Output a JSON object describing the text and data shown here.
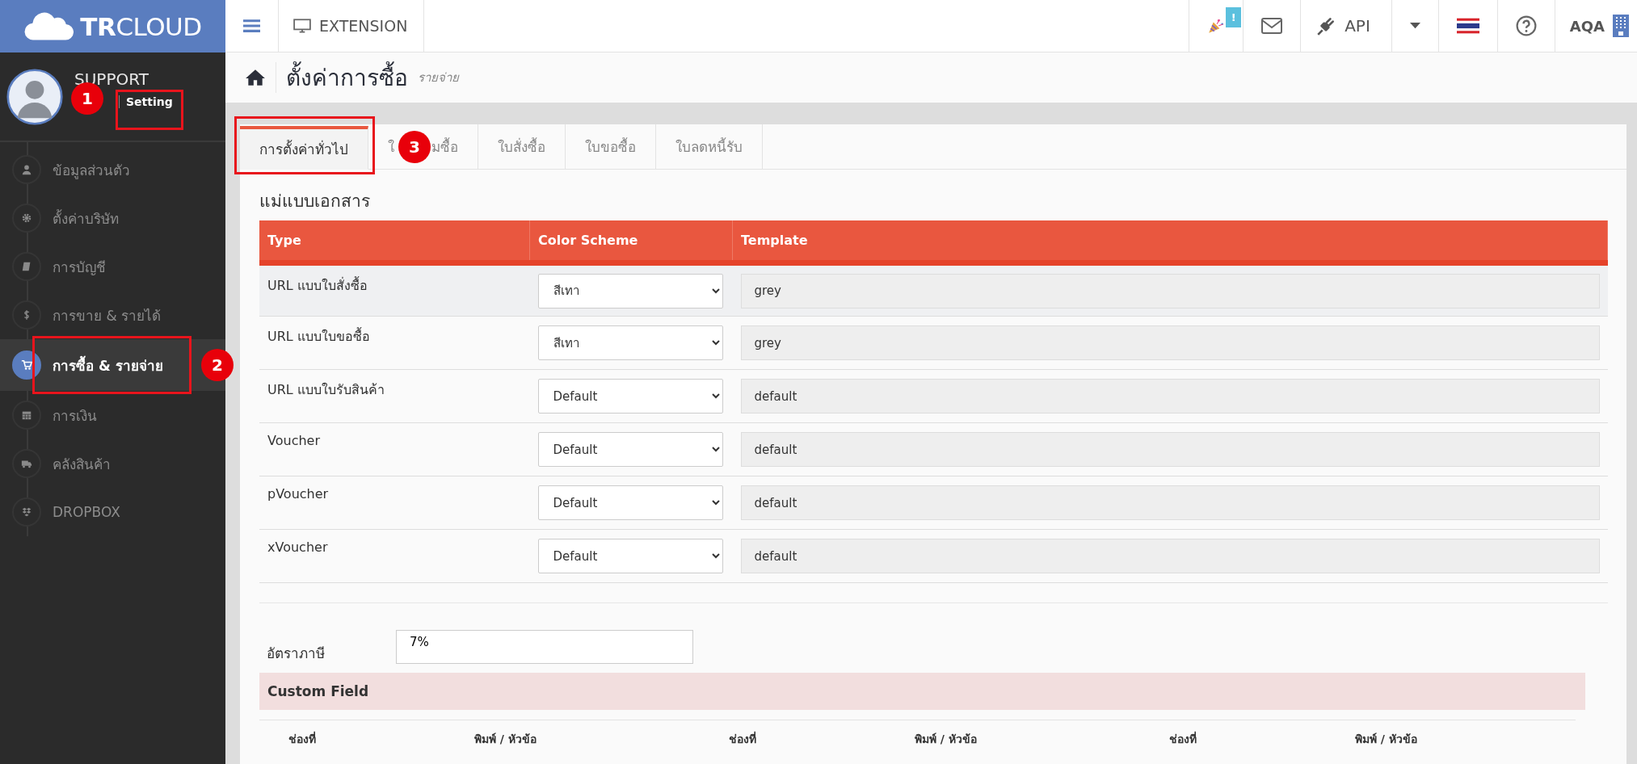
{
  "brand": {
    "name_bold": "TR",
    "name_light": "CLOUD"
  },
  "topbar": {
    "extension": "EXTENSION",
    "notification_badge": "!",
    "api": "API",
    "user": "AQA"
  },
  "profile": {
    "name": "SUPPORT",
    "setting_link": "Setting"
  },
  "sidebar": {
    "items": [
      {
        "label": "ข้อมูลส่วนตัว",
        "selected": false
      },
      {
        "label": "ตั้งค่าบริษัท",
        "selected": false
      },
      {
        "label": "การบัญชี",
        "selected": false
      },
      {
        "label": "การขาย & รายได้",
        "selected": false
      },
      {
        "label": "การซื้อ & รายจ่าย",
        "selected": true
      },
      {
        "label": "การเงิน",
        "selected": false
      },
      {
        "label": "คลังสินค้า",
        "selected": false
      },
      {
        "label": "DROPBOX",
        "selected": false
      }
    ]
  },
  "page": {
    "title": "ตั้งค่าการซื้อ",
    "subtitle": "รายจ่าย"
  },
  "tabs": [
    {
      "label": "การตั้งค่าทั่วไป",
      "selected": true
    },
    {
      "label_start": "ใ",
      "label_end": "มซื้อ",
      "selected": false
    },
    {
      "label": "ใบสั่งซื้อ",
      "selected": false
    },
    {
      "label": "ใบขอซื้อ",
      "selected": false
    },
    {
      "label": "ใบลดหนี้รับ",
      "selected": false
    }
  ],
  "templates": {
    "heading": "แม่แบบเอกสาร",
    "columns": [
      "Type",
      "Color Scheme",
      "Template"
    ],
    "rows": [
      {
        "type": "URL แบบใบสั่งซื้อ",
        "color_scheme": "สีเทา",
        "template": "grey"
      },
      {
        "type": "URL แบบใบขอซื้อ",
        "color_scheme": "สีเทา",
        "template": "grey"
      },
      {
        "type": "URL แบบใบรับสินค้า",
        "color_scheme": "Default",
        "template": "default"
      },
      {
        "type": "Voucher",
        "color_scheme": "Default",
        "template": "default"
      },
      {
        "type": "pVoucher",
        "color_scheme": "Default",
        "template": "default"
      },
      {
        "type": "xVoucher",
        "color_scheme": "Default",
        "template": "default"
      }
    ]
  },
  "tax": {
    "label": "อัตราภาษี",
    "value": "7%"
  },
  "custom_field": {
    "title": "Custom Field",
    "columns": [
      "ช่องที่",
      "พิมพ์ / หัวข้อ",
      "ช่องที่",
      "พิมพ์ / หัวข้อ",
      "ช่องที่",
      "พิมพ์ / หัวข้อ"
    ]
  },
  "annotations": [
    {
      "number": "1"
    },
    {
      "number": "2"
    },
    {
      "number": "3"
    }
  ]
}
